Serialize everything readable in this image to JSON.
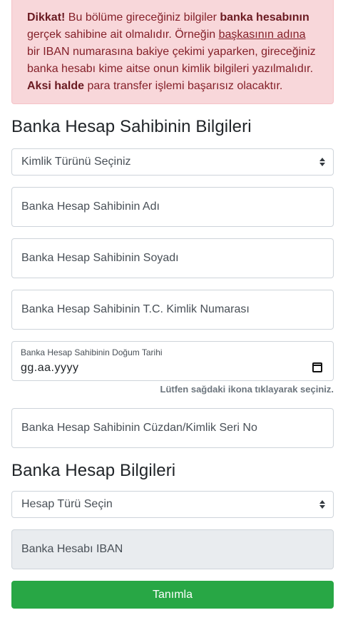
{
  "alert": {
    "dikkat": "Dikkat!",
    "part1": " Bu bölüme gireceğiniz bilgiler ",
    "bank_owner": "banka hesabının",
    "part2": " gerçek sahibine ait olmalıdır. Örneğin ",
    "someone_else": "başkasının adına",
    "part3": " bir IBAN numarasına bakiye çekimi yaparken, gireceğiniz banka hesabı kime aitse onun kimlik bilgileri yazılmalıdır. ",
    "otherwise": "Aksi halde",
    "part4": " para transfer işlemi başarısız olacaktır."
  },
  "section_owner": {
    "title": "Banka Hesap Sahibinin Bilgileri"
  },
  "identity_type": {
    "selected": "Kimlik Türünü Seçiniz"
  },
  "first_name": {
    "placeholder": "Banka Hesap Sahibinin Adı"
  },
  "last_name": {
    "placeholder": "Banka Hesap Sahibinin Soyadı"
  },
  "tc_no": {
    "placeholder": "Banka Hesap Sahibinin T.C. Kimlik Numarası"
  },
  "birth_date": {
    "label": "Banka Hesap Sahibinin Doğum Tarihi",
    "value": "gg.aa.yyyy",
    "hint": "Lütfen sağdaki ikona tıklayarak seçiniz."
  },
  "id_serial": {
    "placeholder": "Banka Hesap Sahibinin Cüzdan/Kimlik Seri No"
  },
  "section_account": {
    "title": "Banka Hesap Bilgileri"
  },
  "account_type": {
    "selected": "Hesap Türü Seçin"
  },
  "iban": {
    "placeholder": "Banka Hesabı IBAN"
  },
  "submit": {
    "label": "Tanımla"
  },
  "colors": {
    "alert_bg": "#f8d7da",
    "alert_text": "#842029",
    "success": "#28a745",
    "disabled_bg": "#e9ecef"
  }
}
